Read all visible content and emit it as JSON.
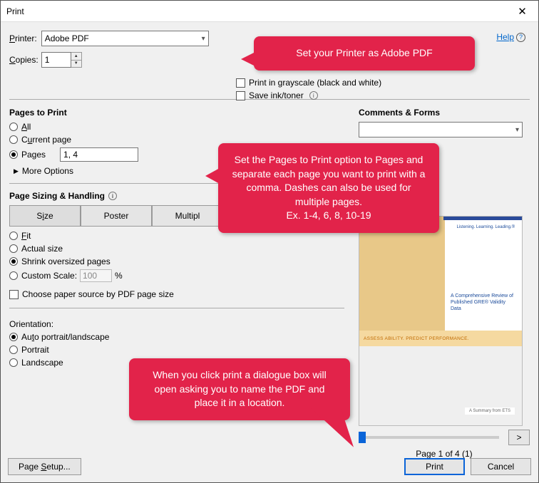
{
  "window": {
    "title": "Print"
  },
  "callouts": {
    "printer": "Set your Printer as Adobe PDF",
    "pages": "Set the Pages to Print option to Pages and separate each page you want to print with a comma. Dashes can also be used for multiple pages.\nEx. 1-4, 6, 8, 10-19",
    "print": "When you click print a dialogue box will open asking you to name the PDF and place it in a location."
  },
  "labels": {
    "printer": "Printer:",
    "copies": "Copies:",
    "help": "Help",
    "grayscale": "Print in grayscale (black and white)",
    "saveink": "Save ink/toner",
    "pages_to_print": "Pages to Print",
    "all": "All",
    "current": "Current page",
    "pages": "Pages",
    "more_options": "More Options",
    "sizing": "Page Sizing & Handling",
    "size": "Size",
    "poster": "Poster",
    "multipl": "Multipl",
    "fit": "Fit",
    "actual": "Actual size",
    "shrink": "Shrink oversized pages",
    "custom_scale": "Custom Scale:",
    "percent": "%",
    "choose_paper": "Choose paper source by PDF page size",
    "orientation": "Orientation:",
    "auto_orient": "Auto portrait/landscape",
    "portrait": "Portrait",
    "landscape": "Landscape",
    "comments_forms": "Comments & Forms",
    "page_indicator": "Page 1 of 4 (1)",
    "page_setup": "Page Setup...",
    "print_btn": "Print",
    "cancel_btn": "Cancel",
    "nav_next": ">"
  },
  "values": {
    "printer": "Adobe PDF",
    "copies": "1",
    "pages_input": "1, 4",
    "scale": "100"
  },
  "preview": {
    "logo": "Listening. Learning. Leading.®",
    "text": "A Comprehensive Review of Published GRE® Validity Data",
    "band": "ASSESS ABILITY. PREDICT PERFORMANCE.",
    "summary": "A Summary from ETS"
  }
}
